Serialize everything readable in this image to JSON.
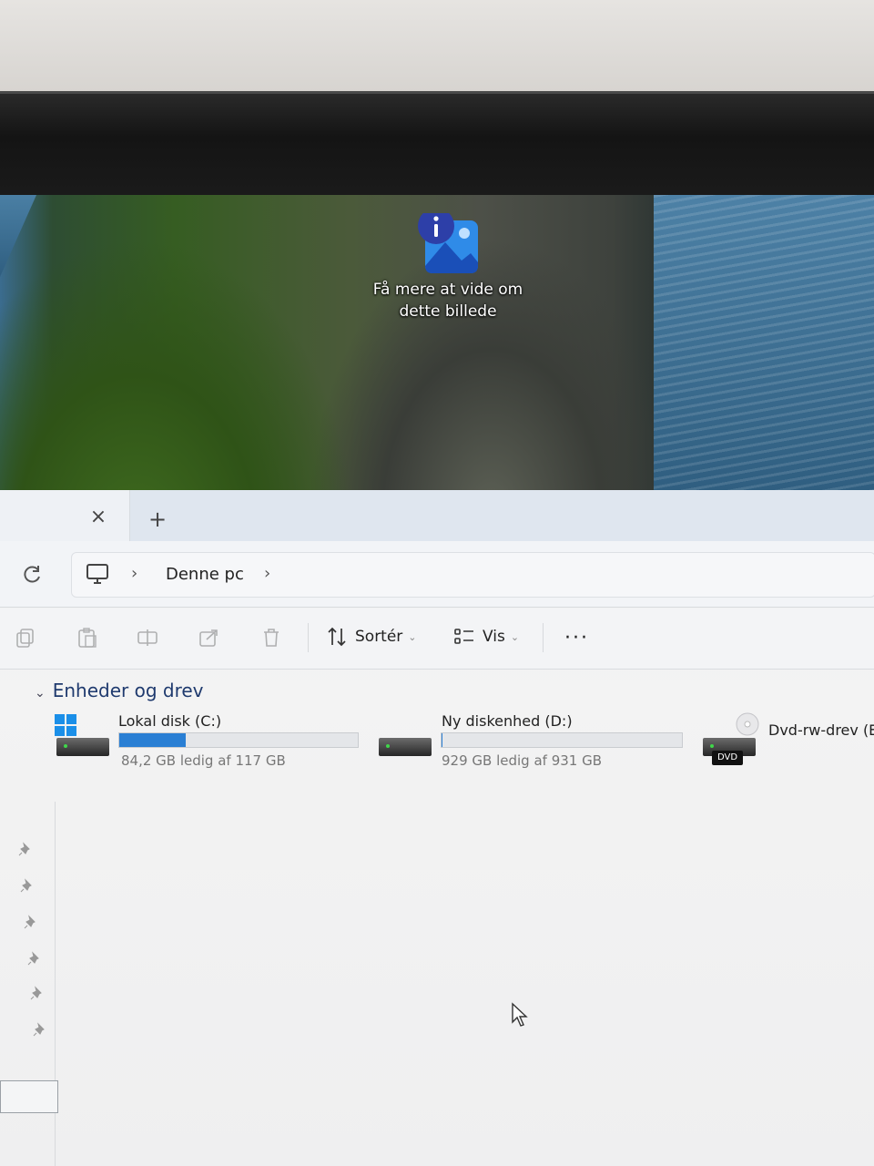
{
  "desktop": {
    "icon": {
      "name": "photo-info-icon",
      "label_line1": "Få mere at vide om",
      "label_line2": "dette billede"
    }
  },
  "explorer": {
    "tabs": {
      "close_glyph": "×",
      "new_tab_glyph": "+"
    },
    "address": {
      "refresh_icon": "refresh-icon",
      "location_icon": "monitor-icon",
      "breadcrumb": "Denne pc",
      "chevron": "›"
    },
    "toolbar": {
      "icons": [
        "copy-icon",
        "paste-icon",
        "rename-icon",
        "share-icon",
        "delete-icon"
      ],
      "sort_label": "Sortér",
      "view_label": "Vis",
      "more_label": "···"
    },
    "section": {
      "title": "Enheder og drev"
    },
    "drives": [
      {
        "name": "Lokal disk (C:)",
        "free_text": "84,2 GB ledig af 117 GB",
        "used_fraction": 0.28,
        "icon": "windows-drive-icon"
      },
      {
        "name": "Ny diskenhed (D:)",
        "free_text": "929 GB ledig af 931 GB",
        "used_fraction": 0.002,
        "icon": "hard-drive-icon"
      },
      {
        "name": "Dvd-rw-drev (E:",
        "badge": "DVD",
        "icon": "dvd-drive-icon"
      }
    ],
    "colors": {
      "accent": "#2a7fd4",
      "section_title": "#1f3a6e"
    }
  }
}
